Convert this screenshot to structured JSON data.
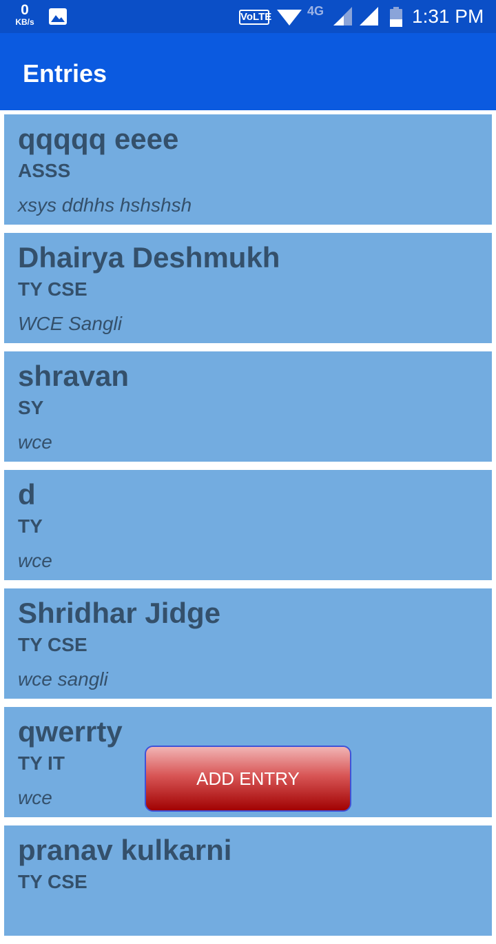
{
  "status_bar": {
    "speed_value": "0",
    "speed_unit": "KB/s",
    "volte": "VoLTE",
    "network": "4G",
    "time": "1:31 PM",
    "icons": [
      "image-icon",
      "wifi-icon",
      "signal-icon",
      "battery-icon"
    ]
  },
  "app_bar": {
    "title": "Entries",
    "color": "#0b5ae0"
  },
  "entries": [
    {
      "name": "qqqqq eeee",
      "class": "ASSS",
      "place": "xsys ddhhs hshshsh"
    },
    {
      "name": "Dhairya Deshmukh",
      "class": "TY CSE",
      "place": "WCE Sangli"
    },
    {
      "name": "shravan",
      "class": "SY",
      "place": "wce"
    },
    {
      "name": "d",
      "class": "TY",
      "place": "wce"
    },
    {
      "name": "Shridhar Jidge",
      "class": "TY CSE",
      "place": "wce sangli"
    },
    {
      "name": "qwerrty",
      "class": "TY IT",
      "place": "wce"
    },
    {
      "name": "pranav kulkarni",
      "class": "TY CSE",
      "place": ""
    }
  ],
  "add_button": {
    "label": "ADD ENTRY"
  }
}
